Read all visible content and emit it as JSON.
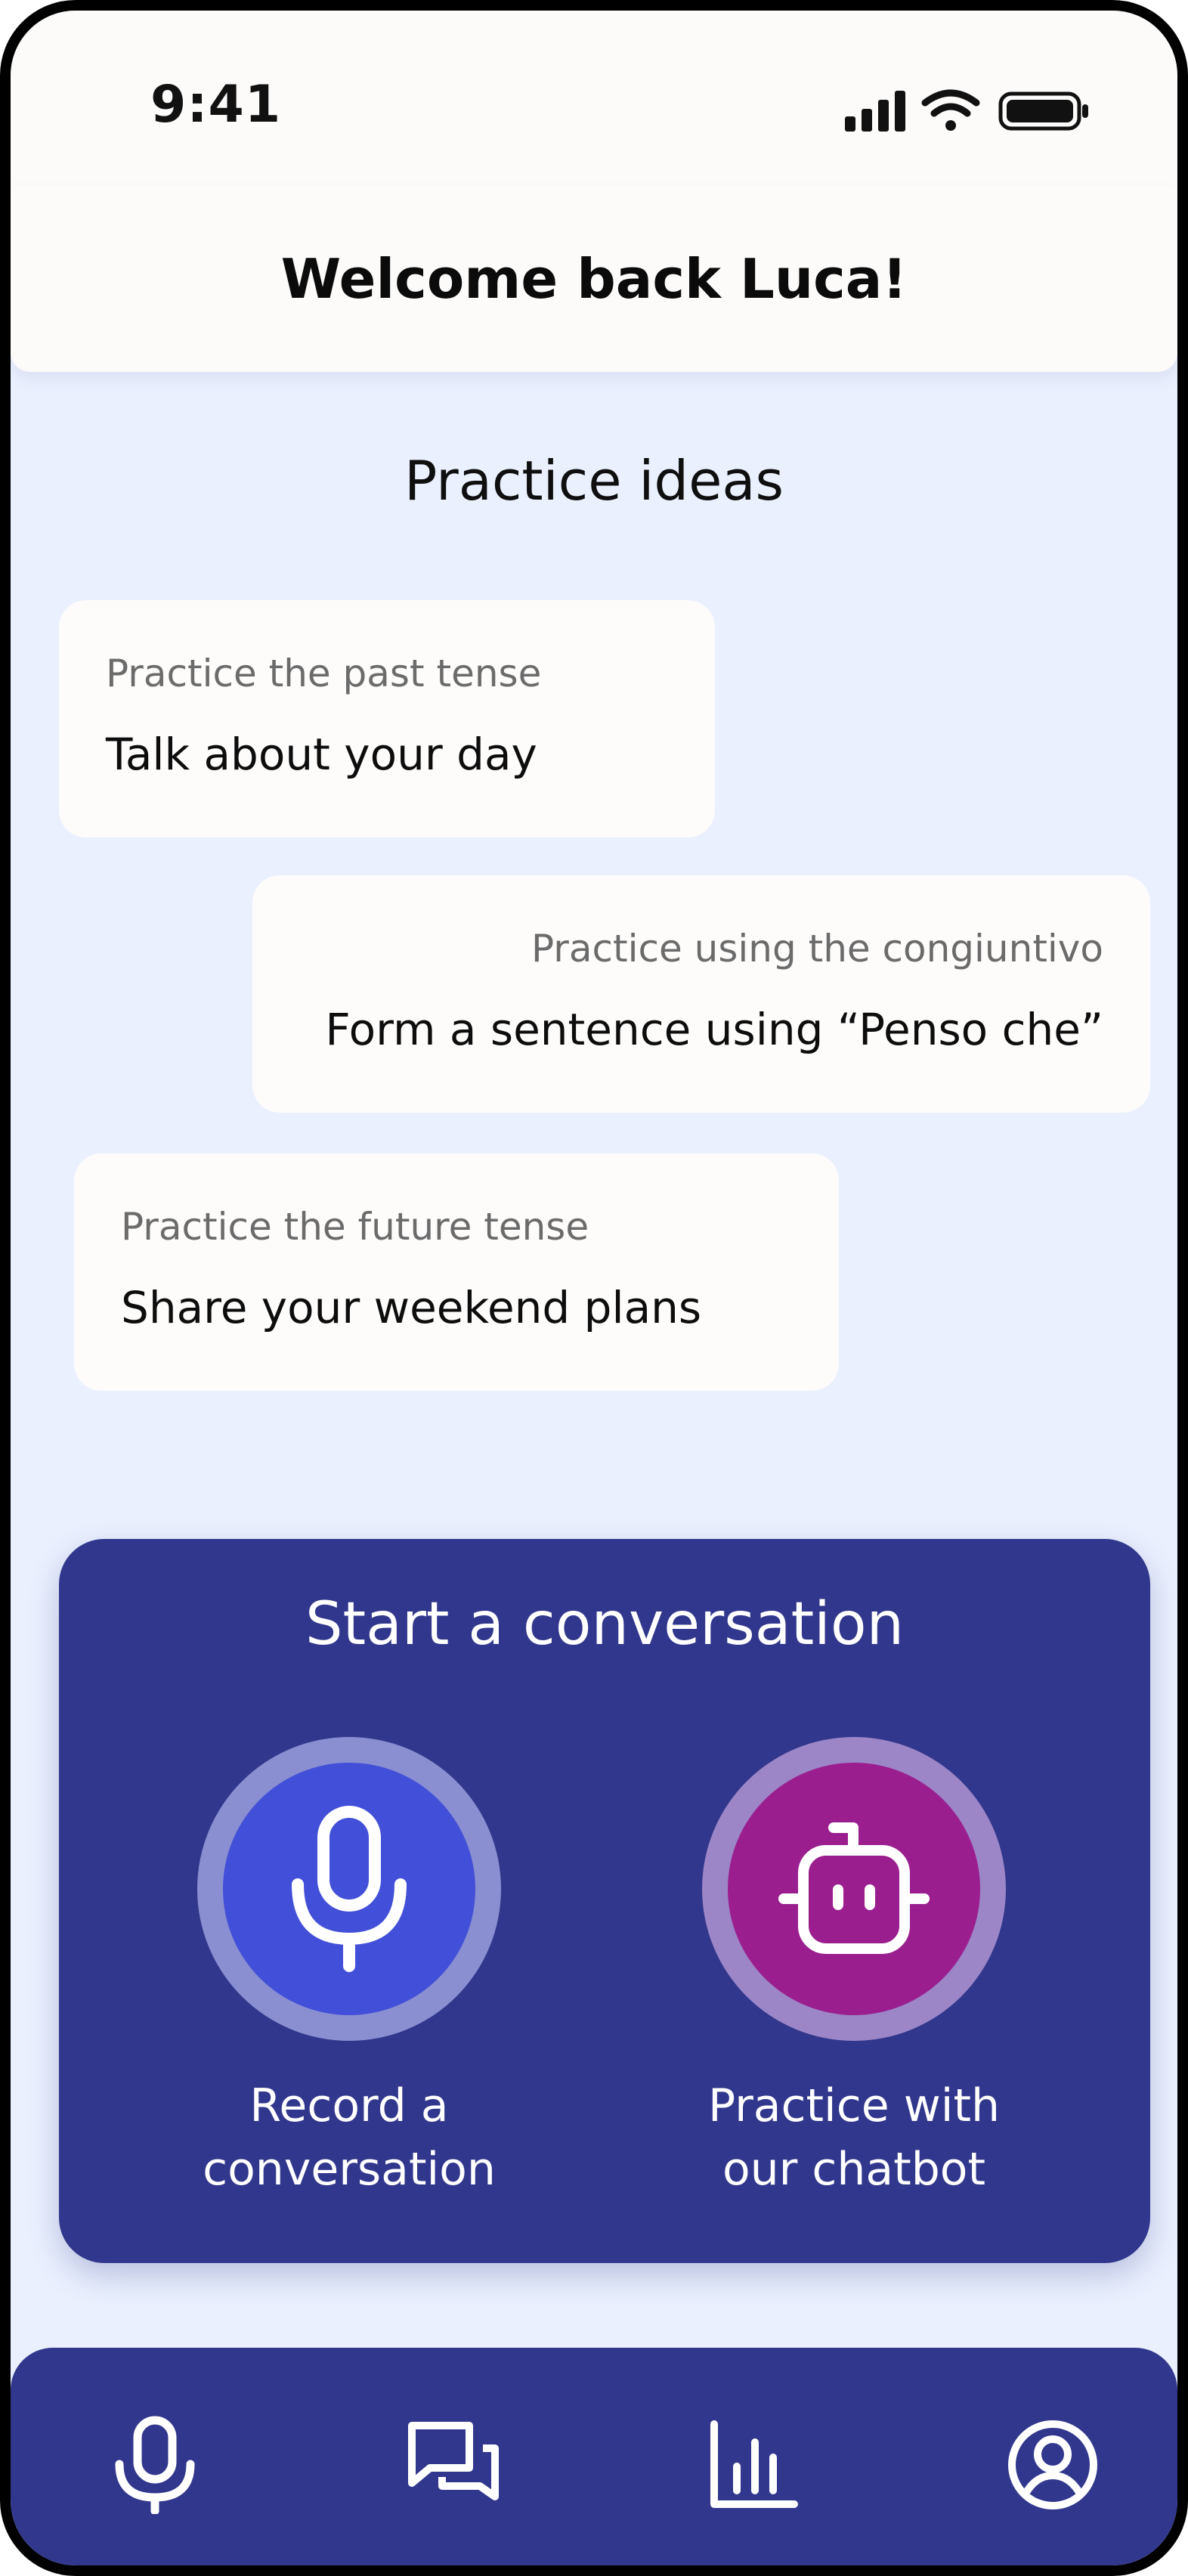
{
  "status_bar": {
    "time": "9:41",
    "icons": [
      "cellular-signal-icon",
      "wifi-icon",
      "battery-icon"
    ]
  },
  "header": {
    "title": "Welcome back Luca!"
  },
  "practice_ideas": {
    "title": "Practice ideas",
    "cards": [
      {
        "subtitle": "Practice the past tense",
        "prompt": "Talk about your day"
      },
      {
        "subtitle": "Practice using the congiuntivo",
        "prompt": "Form a sentence using “Penso che”"
      },
      {
        "subtitle": "Practice the future tense",
        "prompt": "Share your weekend plans"
      }
    ]
  },
  "conversation": {
    "title": "Start a conversation",
    "record": {
      "label_line1": "Record a",
      "label_line2": "conversation",
      "icon": "microphone-icon"
    },
    "chatbot": {
      "label_line1": "Practice with",
      "label_line2": "our chatbot",
      "icon": "robot-icon"
    }
  },
  "bottom_nav": {
    "items": [
      {
        "icon": "microphone-icon"
      },
      {
        "icon": "chat-bubbles-icon"
      },
      {
        "icon": "bar-chart-icon"
      },
      {
        "icon": "profile-icon"
      }
    ]
  },
  "colors": {
    "background": "#EAF0FE",
    "surface": "#FCFBFA",
    "primary_navy": "#31378C",
    "record_blue": "#424FD8",
    "chatbot_magenta": "#9B1E8F"
  }
}
